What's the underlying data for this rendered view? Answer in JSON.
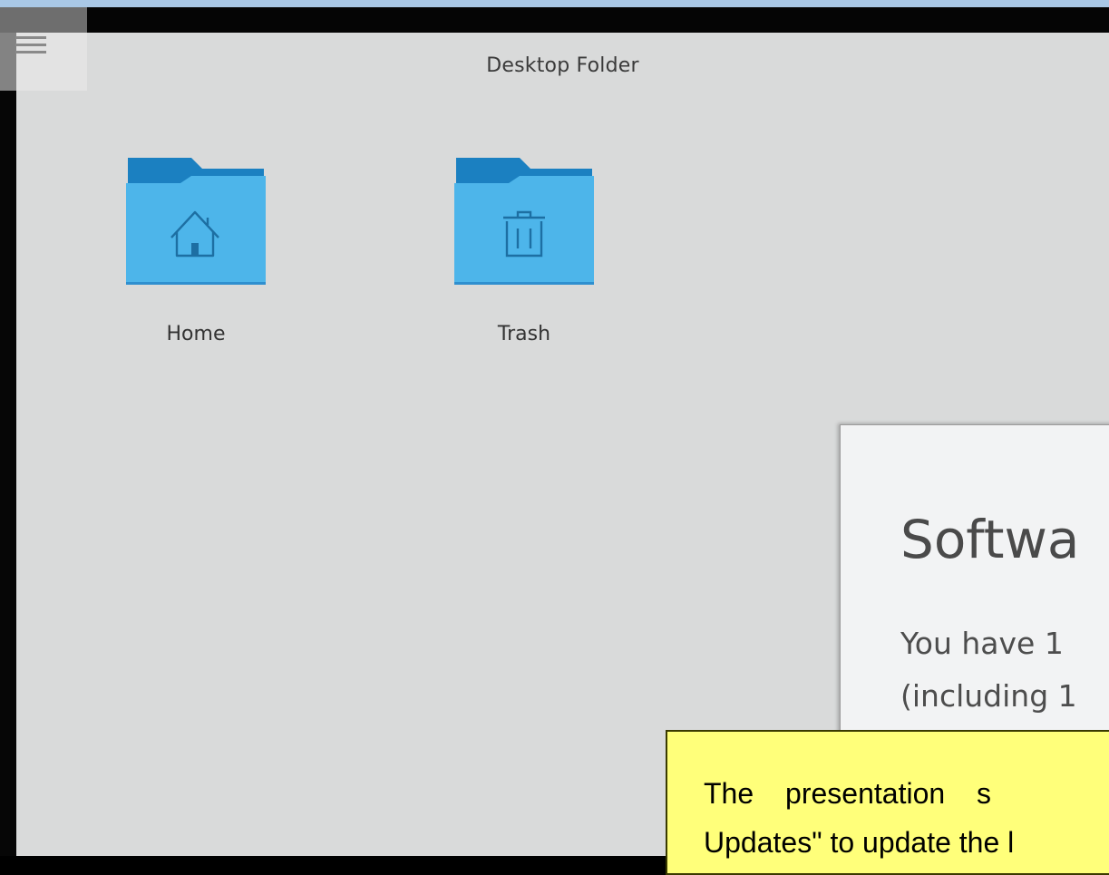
{
  "desktop": {
    "title": "Desktop Folder",
    "icons": [
      {
        "label": "Home",
        "icon": "home-folder-icon"
      },
      {
        "label": "Trash",
        "icon": "trash-folder-icon"
      }
    ]
  },
  "dialog": {
    "title": "Softwa",
    "line1": "You have 1",
    "line2": "(including 1"
  },
  "note": {
    "line1": "The presentation s",
    "line2": "Updates\" to update the l"
  },
  "colors": {
    "folder_front": "#4db5ea",
    "folder_back": "#1b80c1",
    "note_bg": "#ffff7a",
    "desktop_bg": "#d9dada"
  }
}
